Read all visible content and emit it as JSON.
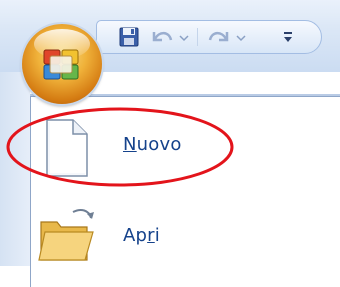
{
  "app": {
    "qat": {
      "save": "save-icon",
      "undo": "undo-icon",
      "redo": "redo-icon",
      "customize": "customize-qat-icon"
    },
    "orb": "office-button-icon"
  },
  "menu": {
    "items": [
      {
        "label_pre": "",
        "label_accel": "N",
        "label_post": "uovo",
        "icon": "new-document-icon"
      },
      {
        "label_pre": "Ap",
        "label_accel": "r",
        "label_post": "i",
        "icon": "open-folder-icon"
      }
    ]
  },
  "colors": {
    "highlight": "#e3141b",
    "menu_text": "#15428b",
    "orb_orange": "#e89a2a"
  }
}
